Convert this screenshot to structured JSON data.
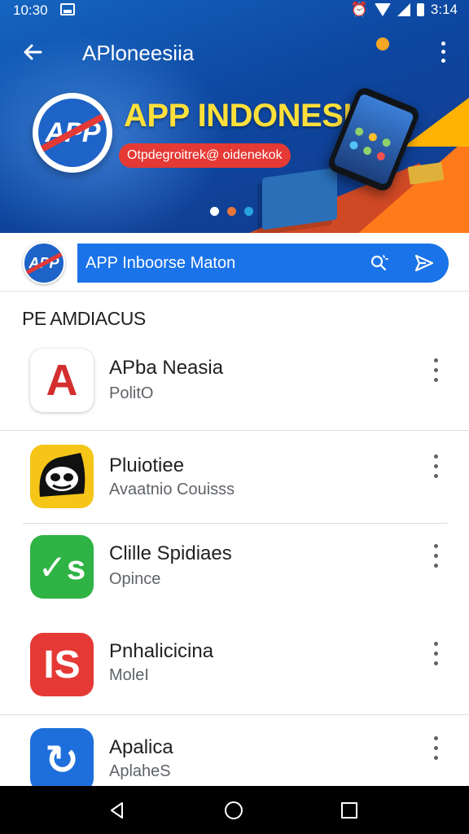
{
  "status_bar": {
    "time_left": "10:30",
    "time_right": "3:14",
    "icons": [
      "image-icon",
      "alarm-icon",
      "wifi-icon",
      "signal-icon",
      "battery-icon"
    ]
  },
  "header": {
    "title": "APloneesiia",
    "back_icon": "arrow-left-icon",
    "more_icon": "more-vert-icon"
  },
  "banner": {
    "logo_text": "APP",
    "headline": "APP INDONESIA",
    "pill_text": "Otpdegroitrek@ oidenekok",
    "carousel_dots": 3,
    "active_dot": 0,
    "colors": {
      "headline": "#ffe03a",
      "pill": "#e53935",
      "background": "#0d47a1",
      "accent_orange": "#ff7a1a"
    }
  },
  "search": {
    "logo_text": "APP",
    "value": "APP Inboorse Maton",
    "icons": [
      "voice-search-icon",
      "send-icon"
    ],
    "color": "#1a73e8"
  },
  "section": {
    "title": "PE AMDIACUS"
  },
  "apps": [
    {
      "name": "APba Neasia",
      "subtitle": "PolitO",
      "icon": "letter-a-app-icon",
      "glyph": "A",
      "bg": "#ffffff",
      "fg": "#d32f2f"
    },
    {
      "name": "Pluiotiee",
      "subtitle": "Avaatnio Couisss",
      "icon": "mask-face-app-icon",
      "glyph": "",
      "bg": "#f5c518",
      "fg": "#111111"
    },
    {
      "name": "Clille Spidiaes",
      "subtitle": "Opince",
      "icon": "green-check-app-icon",
      "glyph": "✓s",
      "bg": "#2fb344",
      "fg": "#ffffff"
    },
    {
      "name": "Pnhalicicina",
      "subtitle": "MoleI",
      "icon": "is-letters-app-icon",
      "glyph": "IS",
      "bg": "#e53935",
      "fg": "#ffffff"
    },
    {
      "name": "Apalica",
      "subtitle": "AplaheS",
      "icon": "refresh-app-icon",
      "glyph": "↻",
      "bg": "#1e6fdc",
      "fg": "#ffffff"
    }
  ],
  "nav": {
    "icons": [
      "back-triangle-icon",
      "home-circle-icon",
      "recents-square-icon"
    ]
  }
}
